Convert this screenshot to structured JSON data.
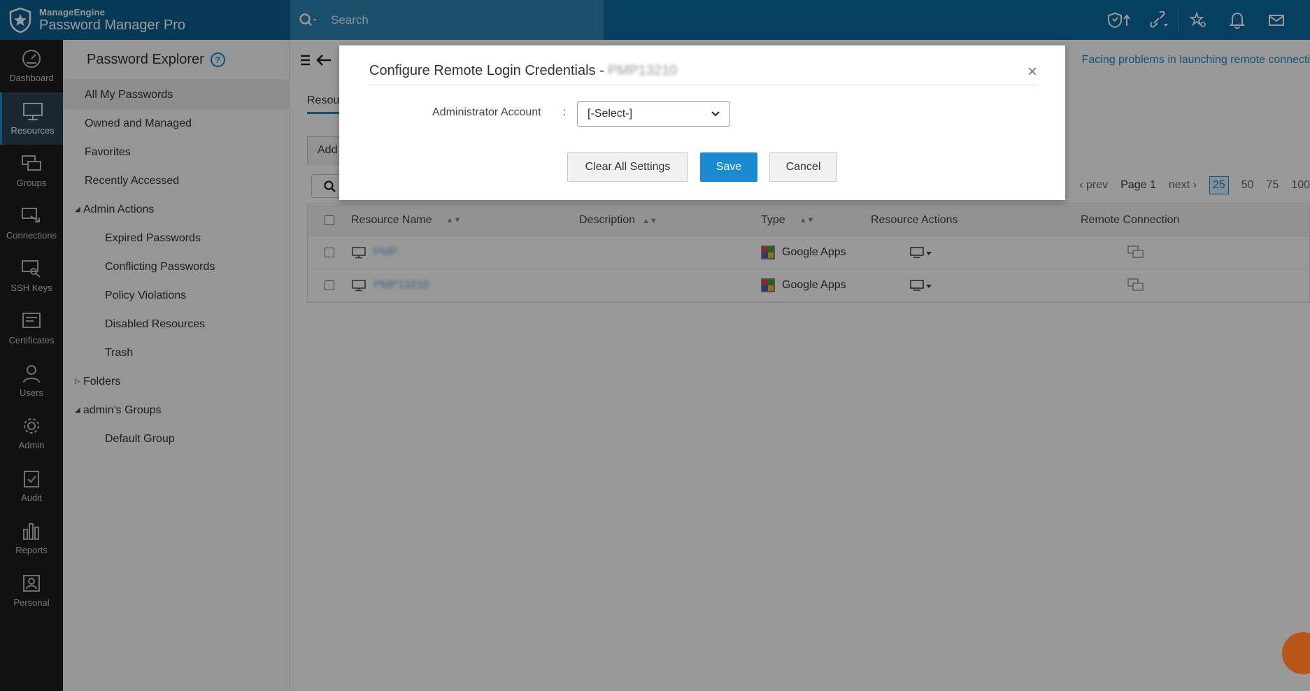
{
  "app": {
    "vendor": "ManageEngine",
    "product": "Password Manager Pro",
    "search_placeholder": "Search"
  },
  "leftnav": [
    {
      "label": "Dashboard",
      "icon": "dashboard-icon"
    },
    {
      "label": "Resources",
      "icon": "monitor-icon",
      "active": true
    },
    {
      "label": "Groups",
      "icon": "groups-icon"
    },
    {
      "label": "Connections",
      "icon": "connections-icon"
    },
    {
      "label": "SSH Keys",
      "icon": "ssh-key-icon"
    },
    {
      "label": "Certificates",
      "icon": "certificate-icon"
    },
    {
      "label": "Users",
      "icon": "user-icon"
    },
    {
      "label": "Admin",
      "icon": "gear-icon"
    },
    {
      "label": "Audit",
      "icon": "clipboard-check-icon"
    },
    {
      "label": "Reports",
      "icon": "bar-chart-icon"
    },
    {
      "label": "Personal",
      "icon": "personal-icon"
    }
  ],
  "explorer": {
    "title": "Password Explorer",
    "help": "?",
    "items": [
      {
        "label": "All My Passwords"
      },
      {
        "label": "Owned and Managed"
      },
      {
        "label": "Favorites"
      },
      {
        "label": "Recently Accessed"
      }
    ],
    "admin_actions": {
      "label": "Admin Actions",
      "items": [
        "Expired Passwords",
        "Conflicting Passwords",
        "Policy Violations",
        "Disabled Resources",
        "Trash"
      ]
    },
    "folders": "Folders",
    "admin_groups": {
      "label": "admin's Groups",
      "items": [
        "Default Group"
      ]
    }
  },
  "main": {
    "banner": "Facing problems in launching remote connecti",
    "tab": "Resou",
    "add_button": "Add",
    "pager": {
      "prev": "prev",
      "page": "Page 1",
      "next": "next",
      "sizes": [
        "25",
        "50",
        "75",
        "100"
      ],
      "selected": "25"
    },
    "columns": [
      "Resource Name",
      "Description",
      "Type",
      "Resource Actions",
      "Remote Connection"
    ],
    "rows": [
      {
        "name": "PMP",
        "description": "",
        "type": "Google Apps"
      },
      {
        "name": "PMP13210",
        "description": "",
        "type": "Google Apps"
      }
    ]
  },
  "modal": {
    "title": "Configure Remote Login Credentials - ",
    "resource": "PMP13210",
    "close": "×",
    "field_label": "Administrator Account",
    "colon": ":",
    "select_value": "[-Select-]",
    "buttons": {
      "clear": "Clear All Settings",
      "save": "Save",
      "cancel": "Cancel"
    }
  },
  "colors": {
    "topbar": "#0a6aa1",
    "accent": "#1a8ad1",
    "leftnav_bg": "#1d1d1d"
  }
}
